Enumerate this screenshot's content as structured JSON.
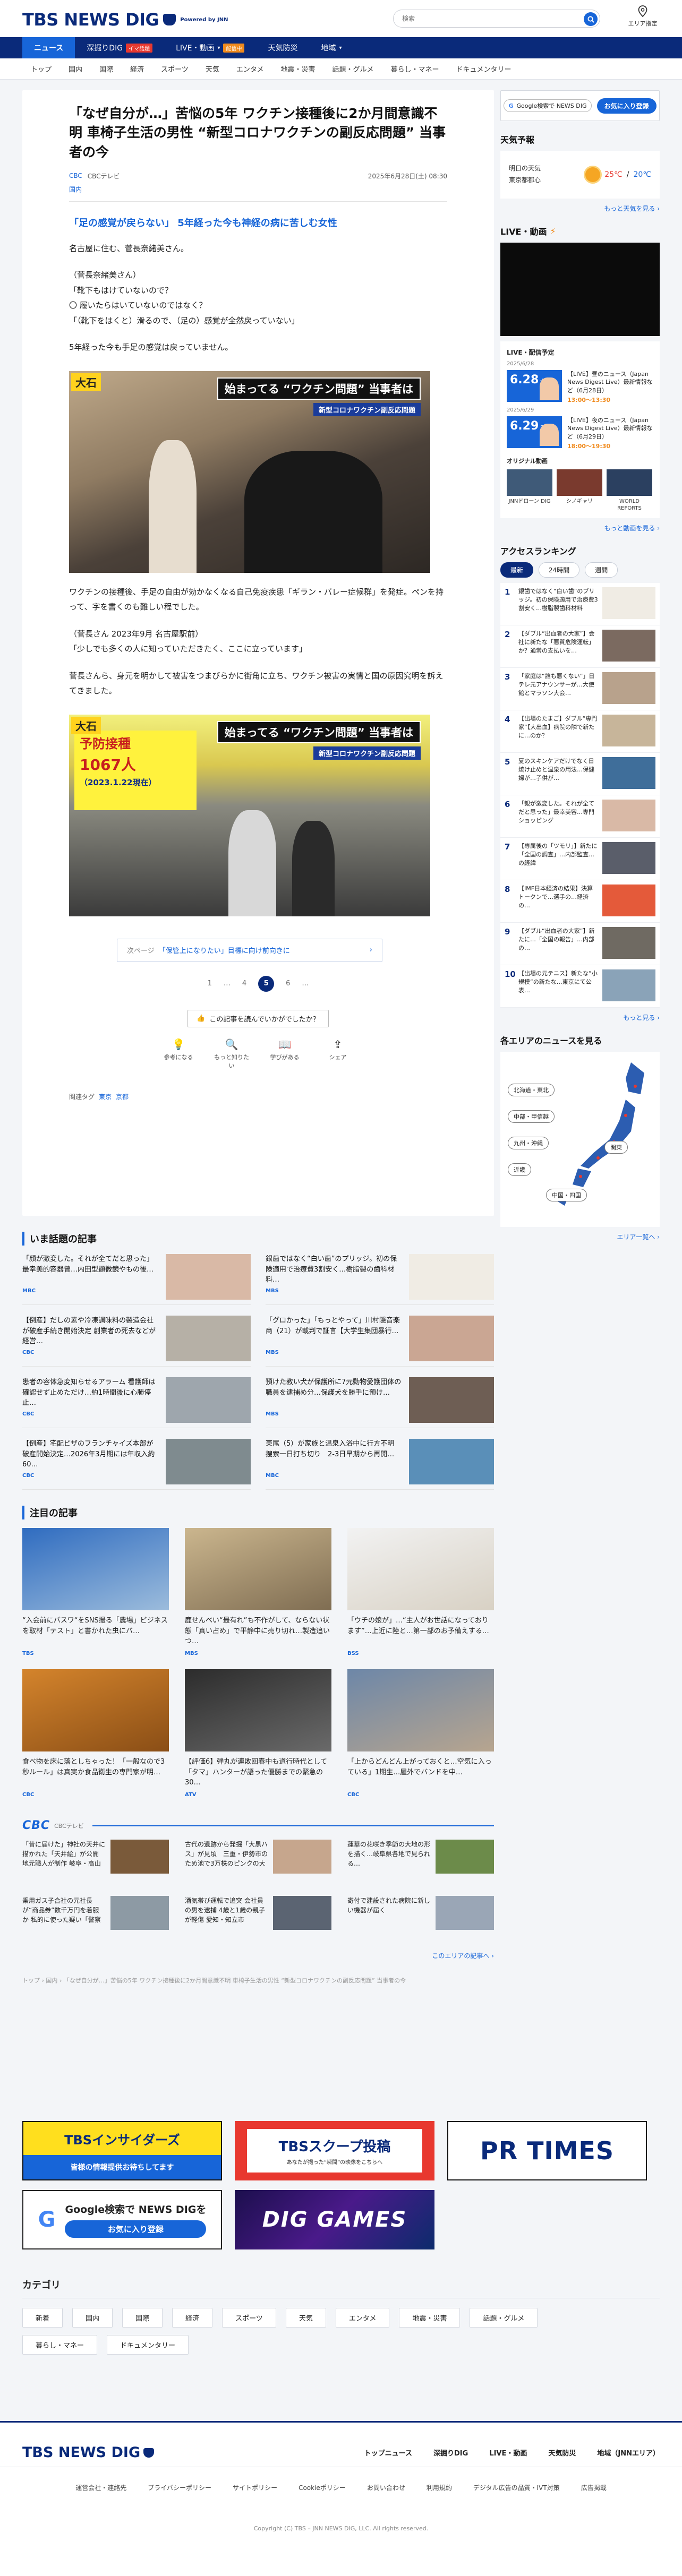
{
  "header": {
    "logo_text": "TBS NEWS DIG",
    "powered": "Powered by JNN",
    "search_placeholder": "検索",
    "area_label": "エリア指定"
  },
  "gnav": [
    {
      "label": "ニュース",
      "active": true
    },
    {
      "label": "深掘りDIG",
      "badge": "イマ話題",
      "badge_color": "red"
    },
    {
      "label": "LIVE・動画",
      "badge": "配信中",
      "badge_color": "orange",
      "caret": "▾"
    },
    {
      "label": "天気防災"
    },
    {
      "label": "地域",
      "caret": "▾"
    }
  ],
  "subnav": [
    "トップ",
    "国内",
    "国際",
    "経済",
    "スポーツ",
    "天気",
    "エンタメ",
    "地震・災害",
    "話題・グルメ",
    "暮らし・マネー",
    "ドキュメンタリー"
  ],
  "article": {
    "title": "「なぜ自分が…」苦悩の5年 ワクチン接種後に2か月間意識不明 車椅子生活の男性 “新型コロナワクチンの副反応問題” 当事者の今",
    "src_link": "CBC",
    "src_name": "CBCテレビ",
    "date": "2025年6月28日(土) 08:30",
    "category": "国内",
    "lead": "「足の感覚が戻らない」 5年経った今も神経の病に苦しむ女性",
    "p1": "名古屋に住む、菅長奈緒美さん。",
    "quote_lines": [
      "（菅長奈緒美さん）",
      "「靴下もはけていないので？",
      "〇 履いたらはいていないのではなく？",
      "「（靴下をはくと）滑るので、（足の）感覚が全然戻っていない」"
    ],
    "p2": "5年経った今も手足の感覚は戻っていません。",
    "photo1_caption_top": "始まってる “ワクチン問題” 当事者は",
    "photo1_caption_sub": "新型コロナワクチン副反応問題",
    "photo1_left": "大石",
    "p3": "ワクチンの接種後、手足の自由が効かなくなる自己免疫疾患「ギラン・バレー症候群」を発症。ペンを持って、字を書くのも難しい程でした。",
    "p4_lines": [
      "（菅長さん 2023年9月 名古屋駅前）",
      "「少しでも多くの人に知っていただきたく、ここに立っています」"
    ],
    "p5": "菅長さんら、身元を明かして被害をつまびらかに街角に立ち、ワクチン被害の実情と国の原因究明を訴えてきました。",
    "photo2_sign_big": "予防接種",
    "photo2_sign_num": "1067人",
    "photo2_sign_sub": "（2023.1.22現在）",
    "photo2_caption_top": "始まってる “ワクチン問題” 当事者は",
    "photo2_caption_sub": "新型コロナワクチン副反応問題",
    "photo2_left": "大石",
    "next_label": "次ページ",
    "next_title": "「保管上になりたい」目標に向け前向きに",
    "pages": [
      "1",
      "…",
      "4",
      "5",
      "6",
      "…"
    ],
    "current_page": "5",
    "feedback_q": "この記事を読んでいかがでしたか？",
    "feedback_btns": [
      "参考になる",
      "もっと知りたい",
      "学びがある",
      "シェア"
    ],
    "tags_label": "関連タグ",
    "tags": [
      "東京",
      "京都"
    ]
  },
  "ima_wadai": {
    "heading": "いま話題の記事",
    "items": [
      {
        "title": "「顔が激変した。それが全てだと思った」最幸美的容器曾…内田型顕微鏡やもの後…",
        "src": "MBC",
        "time": "",
        "img": "#d9b9a6"
      },
      {
        "title": "銀歯ではなく“白い歯”のプリッジ。初の保険適用で治療費3割安く…樹脂製の歯科材料…",
        "src": "MBS",
        "time": "",
        "img": "#f0ece4"
      },
      {
        "title": "【倒産】だしの素や冷凍調味料の製造会社が破産手続き開始決定 創業者の死去などが経営…",
        "src": "CBC",
        "time": "",
        "img": "#b6b0a6"
      },
      {
        "title": "「グロかった」「もっとやって」川村隠音楽商（21）が載判で証言【大学生集団暴行…",
        "src": "MBS",
        "time": "",
        "img": "#caa693"
      },
      {
        "title": "患者の容体急変知らせるアラーム 看護師は確認せず止めただけ…約1時間後に心肺停止…",
        "src": "CBC",
        "time": "",
        "img": "#9ea6ad"
      },
      {
        "title": "預けた教い犬が保護所に7元動物愛護団体の職員を逮捕め分…保護犬を勝手に預け…",
        "src": "MBS",
        "time": "",
        "img": "#6e5e54"
      },
      {
        "title": "【倒産】宅配ピザのフランチャイズ本部が破産開始決定…2026年3月期には年収入約60…",
        "src": "CBC",
        "time": "",
        "img": "#7f8b8f"
      },
      {
        "title": "東尾（5）が家族と温泉入浴中に行方不明　捜索一日打ち切り　2-3日早期から再開…",
        "src": "MBC",
        "time": "",
        "img": "#5a8fb8"
      }
    ]
  },
  "chumoku": {
    "heading": "注目の記事",
    "items": [
      {
        "title": "“入会前にパスワ“をSNS撮る「農場」ビジネスを取材「テスト」と書かれた虫にバ…",
        "src": "TBS",
        "time": "",
        "img1": "#2f6cc0",
        "img2": "#9cbcdc"
      },
      {
        "title": "鹿せんべい“最有れ”も不作がして、ならない状態「真い占め」で平静中に売り切れ…製造追いつ…",
        "src": "MBS",
        "time": "",
        "img1": "#cbb68e",
        "img2": "#7f6d52"
      },
      {
        "title": "「ウチの娘が」…“主人がお世話になっております”…上近に陸と…第一部のお予備えする…",
        "src": "BSS",
        "time": "",
        "img1": "#f2f2f2",
        "img2": "#d8d1c4"
      },
      {
        "title": "食べ物を床に落としちゃった！「一般なので3秒ルール」は真実か食品衛生の専門家が明…",
        "src": "CBC",
        "time": "",
        "img1": "#d4842c",
        "img2": "#8a4e16"
      },
      {
        "title": "【評価6】弾丸が連敗回春中も道行時代として「タマ」ハンターが語った優勝までの緊急の30…",
        "src": "ATV",
        "time": "",
        "img1": "#2c2c2c",
        "img2": "#6a6a6a"
      },
      {
        "title": "「上からどんどん上がっておくと…空気に入っている」1期生…屋外でバンドを中…",
        "src": "CBC",
        "time": "",
        "img1": "#6d87a8",
        "img2": "#b7a58f"
      }
    ]
  },
  "cbc": {
    "logo": "CBC",
    "sub": "CBCテレビ",
    "items": [
      {
        "title": "「昔に届けた」神社の天井に描かれた「天井絵」が公開 地元職人が制作 岐阜・高山市",
        "date": "",
        "img": "#7a5a3a"
      },
      {
        "title": "古代の遺跡から発掘「大黒ハス」が見頃　三重・伊勢市のため池で3万株のピンクの大輪が咲く",
        "date": "",
        "img": "#c6a68d"
      },
      {
        "title": "蓮華の花咲き季節の大地の形を描く…岐阜県各地で見られる…",
        "date": "",
        "img": "#6c8b4a"
      },
      {
        "title": "乗用ガス子合社の元社長が“商品券”数千万円を着服か 私的に使った疑い「警察に相談している」",
        "date": "",
        "img": "#8d9aa4"
      },
      {
        "title": "酒気帯び運転で追突 会社員の男を逮捕 4歳と1歳の親子が軽傷 愛知・知立市",
        "date": "",
        "img": "#5b6472"
      },
      {
        "title": "寄付で建設された病院に新しい機器が届く",
        "date": "",
        "img": "#9aa6b6"
      }
    ],
    "more": "このエリアの記事へ ›"
  },
  "breadcrumb": "トップ › 国内 › 「なぜ自分が…」苦悩の5年 ワクチン接種後に2か月間意識不明 車椅子生活の男性 “新型コロナワクチンの副反応問題” 当事者の今",
  "banners": {
    "insiders_top": "TBSインサイダーズ",
    "insiders_bot": "皆様の情報提供お待ちしてます",
    "scoop_big": "TBSスクープ投稿",
    "scoop_sm": "あなたが撮った“瞬間”の映像をこちらへ",
    "prtimes": "PR TIMES",
    "google_t1": "Google検索で NEWS DIGを",
    "google_t2": "お気に入り登録",
    "dig_games": "DIG GAMES"
  },
  "categories": {
    "heading": "カテゴリ",
    "items": [
      "新着",
      "国内",
      "国際",
      "経済",
      "スポーツ",
      "天気",
      "エンタメ",
      "地震・災害",
      "話題・グルメ",
      "暮らし・マネー",
      "ドキュメンタリー"
    ]
  },
  "footer": {
    "logo": "TBS NEWS DIG",
    "nav": [
      "トップニュース",
      "深掘りDIG",
      "LIVE・動画",
      "天気防災",
      "地域（JNNエリア）"
    ],
    "links": [
      "運営会社・連絡先",
      "プライバシーポリシー",
      "サイトポリシー",
      "Cookieポリシー",
      "お問い合わせ",
      "利用規約",
      "デジタル広告の品質・IVT対策",
      "広告掲載"
    ],
    "copyright": "Copyright (C) TBS – JNN NEWS DIG, LLC. All rights reserved."
  },
  "sidebar": {
    "gsearch_label": "Google検索で NEWS DIG",
    "gsearch_btn": "お気に入り登録",
    "weather_h": "天気予報",
    "weather_day": "明日の天気",
    "weather_place": "東京都都心",
    "weather_hi": "25℃",
    "weather_lo": "20℃",
    "weather_more": "もっと天気を見る ›",
    "live_h": "LIVE・動画",
    "sched_h": "LIVE・配信予定",
    "sched": [
      {
        "date": "2025/6/28",
        "day": "6.28",
        "wk": "土",
        "title": "【LIVE】昼のニュース（Japan News Digest Live）最新情報など（6月28日）",
        "time": "13:00～13:30"
      },
      {
        "date": "2025/6/29",
        "day": "6.29",
        "wk": "日",
        "title": "【LIVE】夜のニュース（Japan News Digest Live）最新情報など（6月29日）",
        "time": "18:00～19:30"
      }
    ],
    "orig_h": "オリジナル動画",
    "orig": [
      {
        "label": "JNNドローン DIG",
        "img": "#3f5a78"
      },
      {
        "label": "シノギャリ",
        "img": "#7a3a2e"
      },
      {
        "label": "WORLD REPORTS",
        "img": "#2b4060"
      }
    ],
    "live_more": "もっと動画を見る ›",
    "rank_h": "アクセスランキング",
    "rank_tabs": [
      "最新",
      "24時間",
      "週間"
    ],
    "rank_active": "最新",
    "ranking": [
      {
        "no": "1",
        "title": "銀歯ではなく“白い歯”のブリッジ。初の保険適用で治療費3割安く…樹脂製歯科材料",
        "img": "#f0ece4"
      },
      {
        "no": "2",
        "title": "【ダブル“出血者の大家”】会社に新たな「悪質危険運転」か？通常の支払いを…",
        "img": "#7b6a60"
      },
      {
        "no": "3",
        "title": "「家庭は“誰も悪くない”」日テレ元アナウンサーが…大使館とマラソン大会…",
        "img": "#b8a28c"
      },
      {
        "no": "4",
        "title": "【出場のたまご】ダブル“専門家”【大出血】病院の隣で新たに…のか？",
        "img": "#c7b59a"
      },
      {
        "no": "5",
        "title": "夏のスキンケアだけでなく日焼け止めと温泉の用法…保健婦が…子供が…",
        "img": "#3f6e9a"
      },
      {
        "no": "6",
        "title": "「親が激変した。それが全てだと思った」最幸美容…専門ショッピング",
        "img": "#d9b9a6"
      },
      {
        "no": "7",
        "title": "【専属後の「ツモリ」】新たに「全国の調査」…内部監査…の経緯",
        "img": "#5a5e6a"
      },
      {
        "no": "8",
        "title": "【IMF日本経済の結果】決算トークンで…選手の…経済の…",
        "img": "#e45a3a"
      },
      {
        "no": "9",
        "title": "【ダブル“出血者の大家”】新たに…「全国の報告」…内部の…",
        "img": "#6f6a62"
      },
      {
        "no": "10",
        "title": "【出場の元テニス】新たな“小規模”の新たな…東京にて公表…",
        "img": "#8aa3b8"
      }
    ],
    "rank_more": "もっと見る ›",
    "area_h": "各エリアのニュースを見る",
    "areas": [
      "北海道・東北",
      "関東",
      "中部・甲信越",
      "近畿",
      "中国・四国",
      "九州・沖縄"
    ],
    "area_more": "エリア一覧へ ›"
  }
}
